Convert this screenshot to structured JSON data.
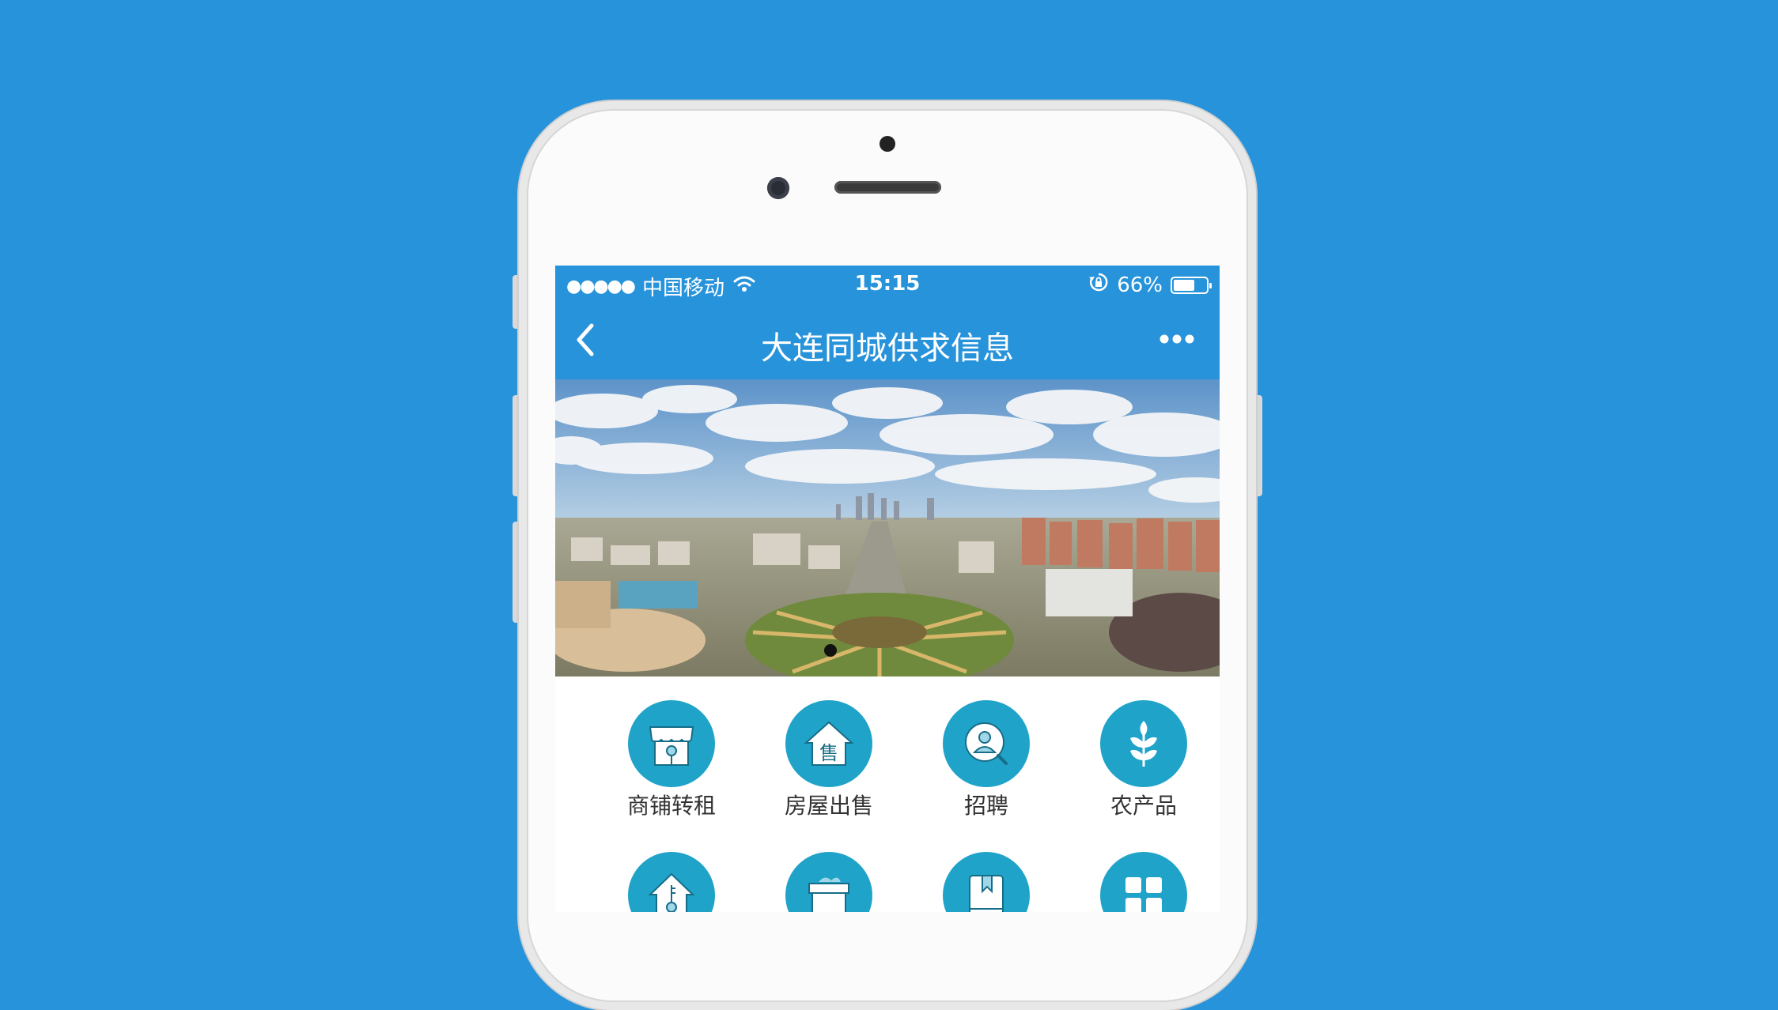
{
  "status_bar": {
    "signal": "●●●●●",
    "carrier": "中国移动",
    "time": "15:15",
    "battery_percent": "66%",
    "battery_level": 0.66
  },
  "nav": {
    "title": "大连同城供求信息"
  },
  "banner": {
    "pagination_count": 1,
    "active_index": 0
  },
  "grid": {
    "items": [
      {
        "label": "商铺转租",
        "icon": "shop-rent-icon"
      },
      {
        "label": "房屋出售",
        "icon": "house-sale-icon"
      },
      {
        "label": "招聘",
        "icon": "recruitment-icon"
      },
      {
        "label": "农产品",
        "icon": "agriculture-icon"
      },
      {
        "label": "",
        "icon": "house-key-icon"
      },
      {
        "label": "",
        "icon": "box-icon"
      },
      {
        "label": "",
        "icon": "book-icon"
      },
      {
        "label": "",
        "icon": "apps-grid-icon"
      }
    ]
  },
  "colors": {
    "background": "#2793db",
    "header": "#2793db",
    "icon_circle": "#1fa3c9"
  }
}
